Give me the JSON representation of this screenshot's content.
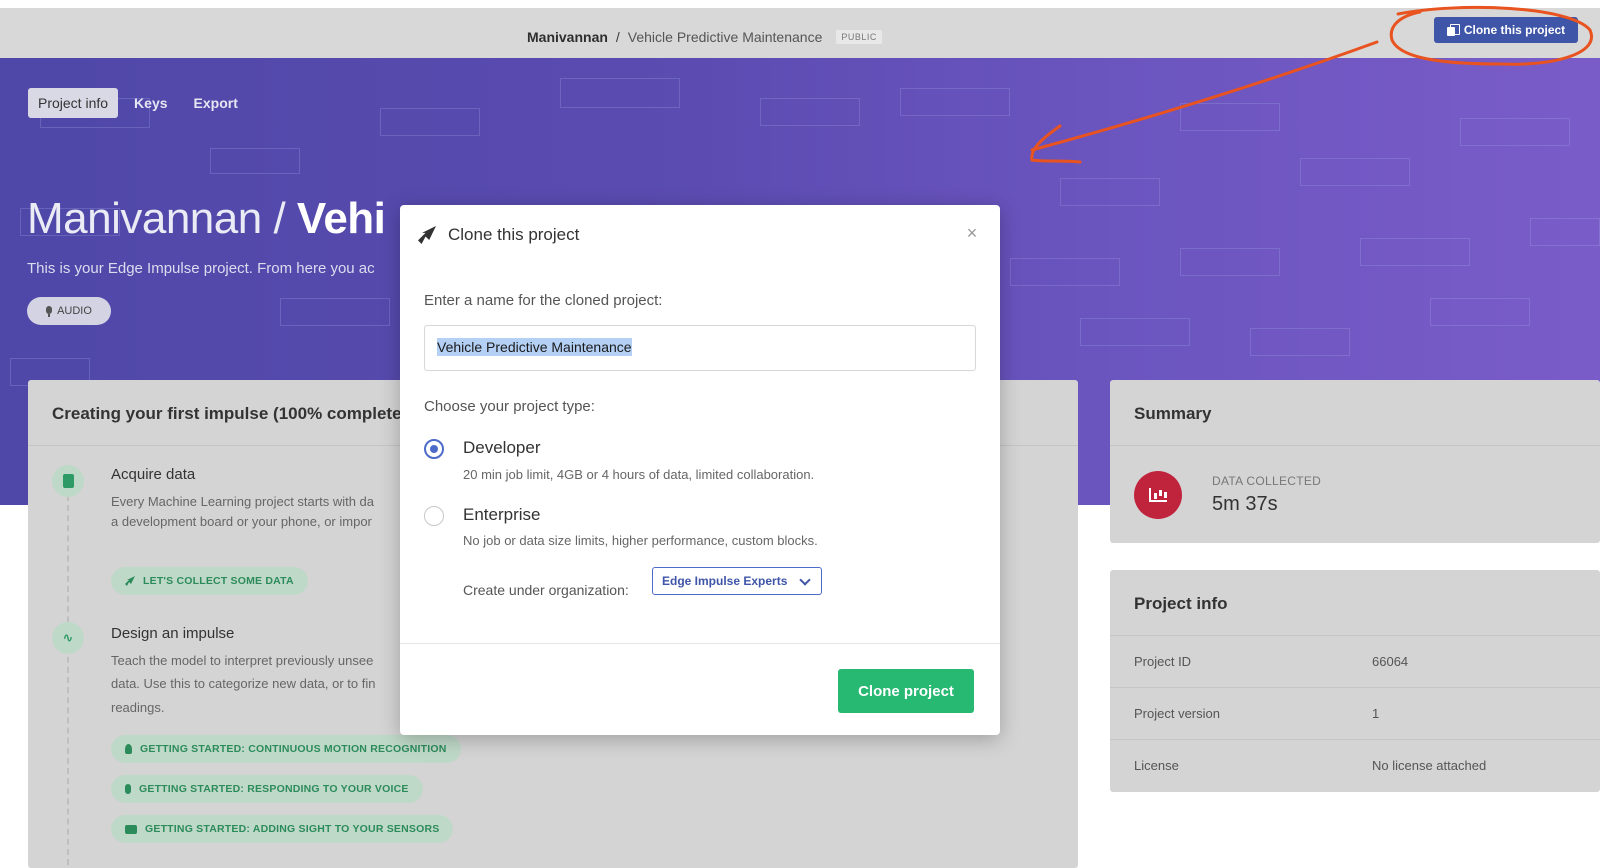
{
  "topbar": {
    "owner": "Manivannan",
    "separator": "/",
    "project": "Vehicle Predictive Maintenance",
    "visibility": "PUBLIC",
    "clone_button": "Clone this project"
  },
  "hero": {
    "tabs": [
      {
        "label": "Project info",
        "active": true
      },
      {
        "label": "Keys",
        "active": false
      },
      {
        "label": "Export",
        "active": false
      }
    ],
    "title_owner": "Manivannan /",
    "title_project": "Vehi",
    "subtitle": "This is your Edge Impulse project. From here you ac",
    "tag": "AUDIO"
  },
  "impulse_card": {
    "title": "Creating your first impulse (100% complete",
    "steps": [
      {
        "title": "Acquire data",
        "text": [
          "Every Machine Learning project starts with da",
          "a development board or your phone, or impor"
        ],
        "chips": [
          "LET'S COLLECT SOME DATA"
        ]
      },
      {
        "title": "Design an impulse",
        "text": [
          "Teach the model to interpret previously unsee",
          "data. Use this to categorize new data, or to fin",
          "readings."
        ],
        "chips": [
          "GETTING STARTED: CONTINUOUS MOTION RECOGNITION",
          "GETTING STARTED: RESPONDING TO YOUR VOICE",
          "GETTING STARTED: ADDING SIGHT TO YOUR SENSORS"
        ]
      }
    ]
  },
  "summary": {
    "title": "Summary",
    "label": "DATA COLLECTED",
    "value": "5m 37s"
  },
  "project_info": {
    "title": "Project info",
    "rows": [
      {
        "key": "Project ID",
        "value": "66064"
      },
      {
        "key": "Project version",
        "value": "1"
      },
      {
        "key": "License",
        "value": "No license attached"
      }
    ]
  },
  "modal": {
    "title": "Clone this project",
    "close": "×",
    "name_label": "Enter a name for the cloned project:",
    "name_value": "Vehicle Predictive Maintenance",
    "type_label": "Choose your project type:",
    "options": [
      {
        "title": "Developer",
        "desc": "20 min job limit, 4GB or 4 hours of data, limited collaboration.",
        "checked": true
      },
      {
        "title": "Enterprise",
        "desc": "No job or data size limits, higher performance, custom blocks.",
        "checked": false
      }
    ],
    "org_label": "Create under organization:",
    "org_value": "Edge Impulse Experts",
    "submit": "Clone project"
  },
  "colors": {
    "accent": "#3f55a8",
    "success": "#27b872",
    "danger": "#c0233c",
    "annotation": "#e8531f"
  }
}
